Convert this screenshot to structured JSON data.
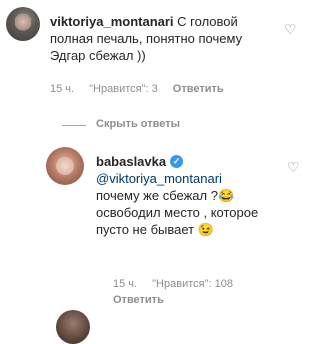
{
  "comment1": {
    "username": "viktoriya_montanari",
    "text": "С головой полная печаль, понятно почему Эдгар сбежал ))",
    "time": "15 ч.",
    "likes": "\"Нравится\": 3",
    "reply": "Ответить"
  },
  "hide_replies": "Скрыть ответы",
  "comment2": {
    "username": "babaslavka",
    "verified_icon": "verified-badge-icon",
    "mention": "@viktoriya_montanari",
    "text": "почему же сбежал ?😂 освободил место , которое пусто не бывает 😉",
    "time": "15 ч.",
    "likes": "\"Нравится\": 108",
    "reply": "Ответить"
  },
  "icons": {
    "like": "heart-outline-icon"
  }
}
